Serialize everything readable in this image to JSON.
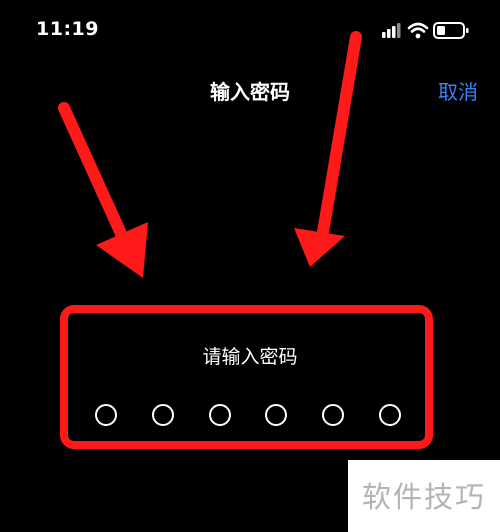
{
  "status_bar": {
    "time": "11:19"
  },
  "nav": {
    "title": "输入密码",
    "cancel_label": "取消"
  },
  "passcode": {
    "prompt": "请输入密码",
    "digit_count": 6
  },
  "watermark": {
    "text": "软件技巧"
  },
  "colors": {
    "background": "#000000",
    "accent": "#3a82f7",
    "annotation_red": "#ff1a1a"
  },
  "icons": [
    "signal-bars-icon",
    "wifi-icon",
    "battery-icon"
  ]
}
